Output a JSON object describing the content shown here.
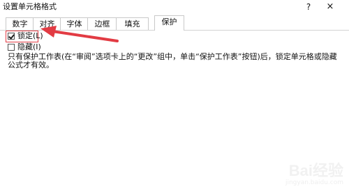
{
  "window": {
    "title": "设置单元格格式",
    "help_label": "?",
    "close_label": "×"
  },
  "tabs": [
    {
      "label": "数字",
      "active": false
    },
    {
      "label": "对齐",
      "active": false
    },
    {
      "label": "字体",
      "active": false
    },
    {
      "label": "边框",
      "active": false
    },
    {
      "label": "填充",
      "active": false
    },
    {
      "label": "保护",
      "active": true
    }
  ],
  "protection": {
    "locked": {
      "label": "锁定(L)",
      "checked": true
    },
    "hidden": {
      "label": "隐藏(I)",
      "checked": false
    },
    "note": "只有保护工作表(在“审阅”选项卡上的“更改”组中，单击“保护工作表”按钮)后，锁定单元格或隐藏公式才有效。"
  },
  "annotation": {
    "arrow_color": "#e23b43",
    "box_color": "#e23b43"
  },
  "watermark": {
    "main": "Bai经验",
    "sub": "jingyan.baidu.com"
  }
}
